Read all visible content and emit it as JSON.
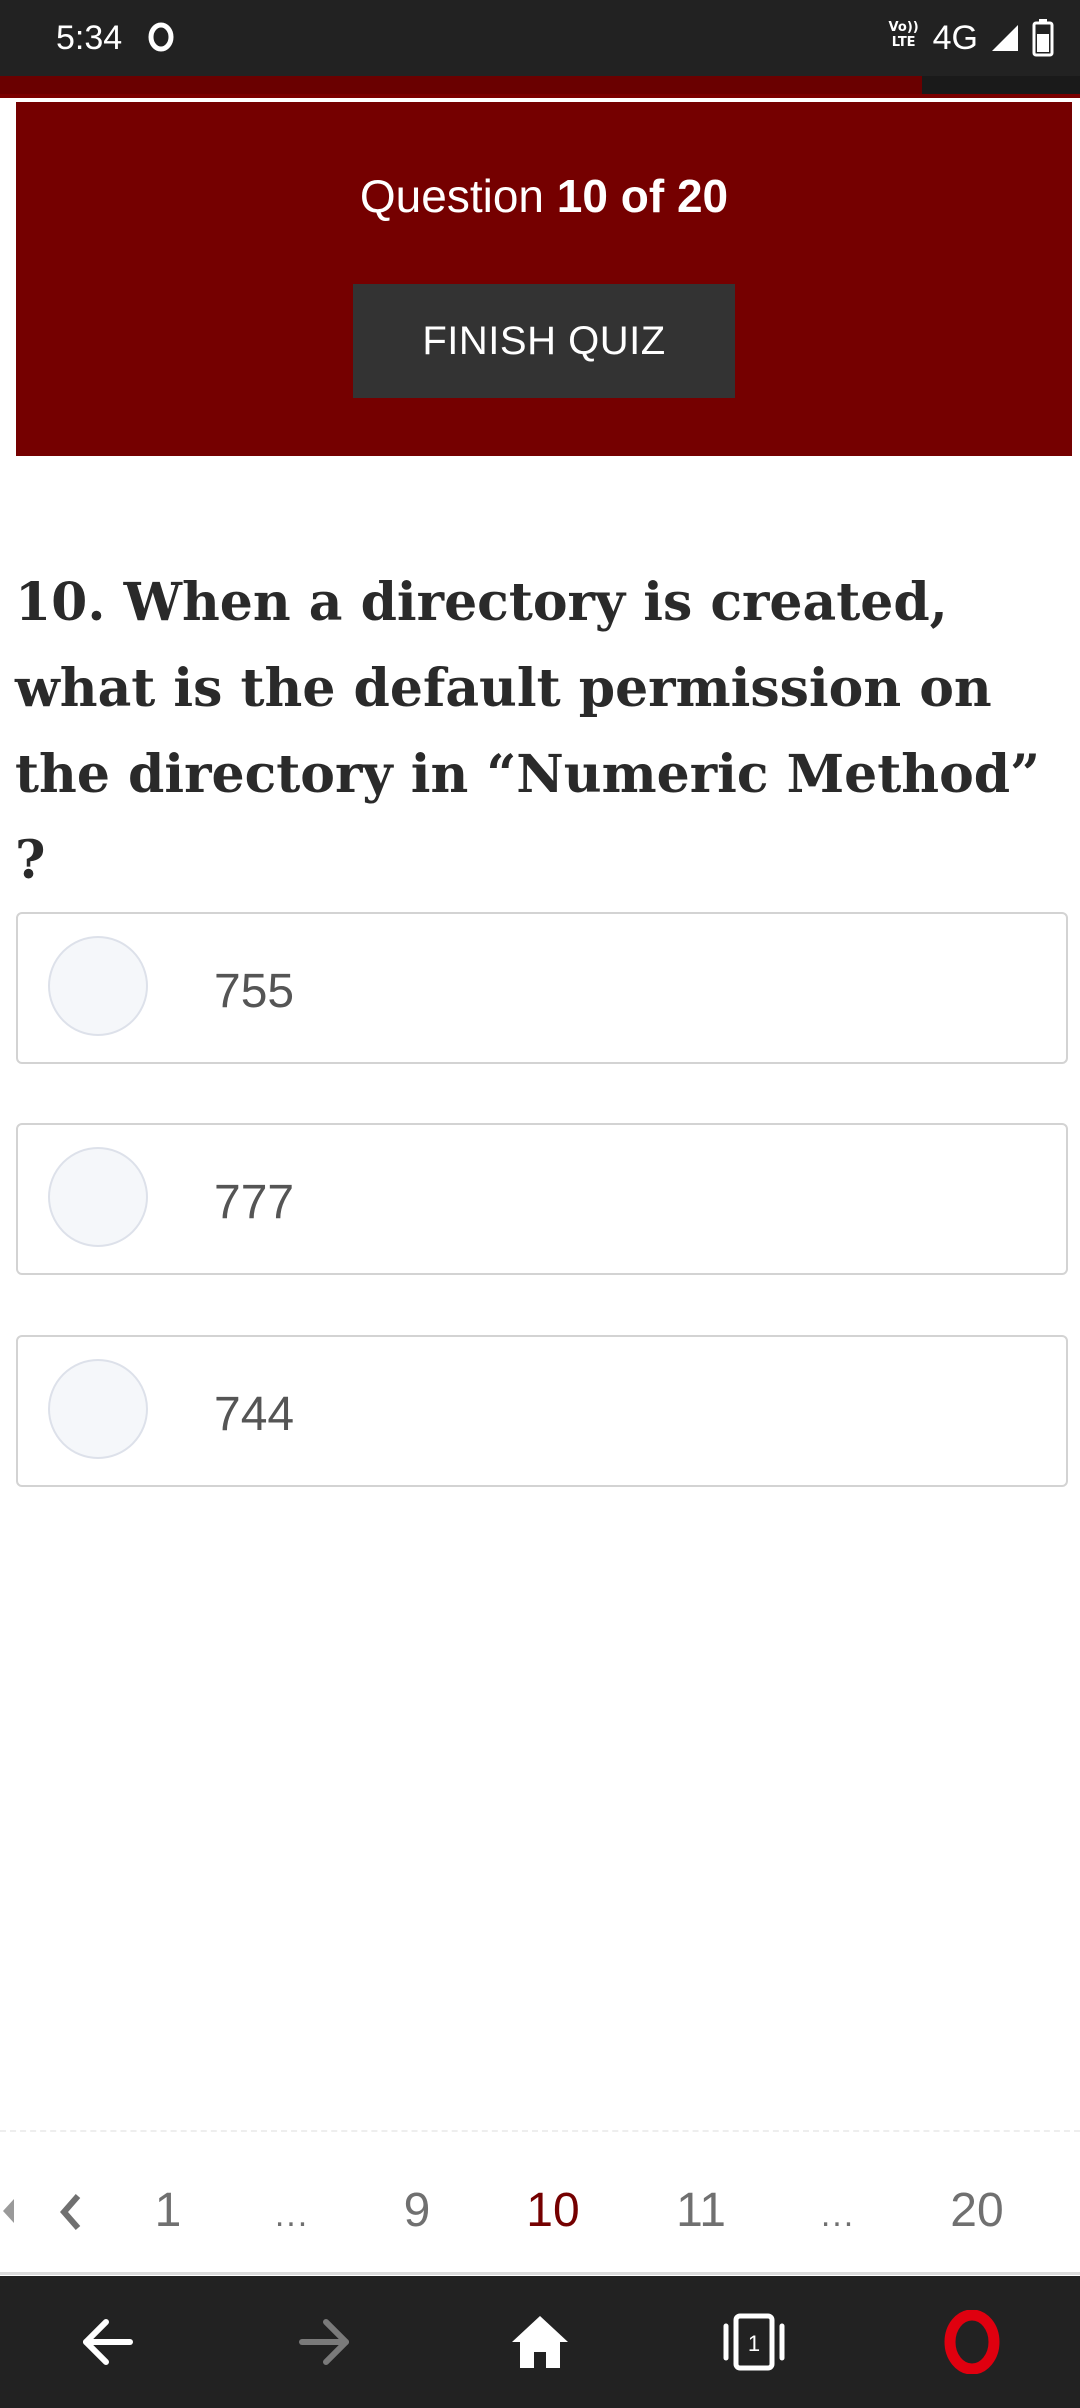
{
  "status_bar": {
    "time": "5:34",
    "volte_top": "Vo))",
    "volte_bottom": "LTE",
    "network": "4G"
  },
  "quiz": {
    "counter_prefix": "Question",
    "counter_value": "10 of 20",
    "finish_button_label": "FINISH QUIZ"
  },
  "question": {
    "text": "10. When a directory is created, what is the default permission on the directory in “Numeric Method” ?"
  },
  "answers": [
    {
      "label": "755"
    },
    {
      "label": "777"
    },
    {
      "label": "744"
    }
  ],
  "pagination": {
    "first": "1",
    "ellipsis_left": "...",
    "prev": "9",
    "current": "10",
    "next": "11",
    "ellipsis_right": "...",
    "last": "20"
  },
  "browser_nav": {
    "tab_count": "1"
  },
  "colors": {
    "header_background": "#750000",
    "finish_button": "#333333",
    "current_page": "#750000",
    "opera_brand": "#e0000f"
  }
}
